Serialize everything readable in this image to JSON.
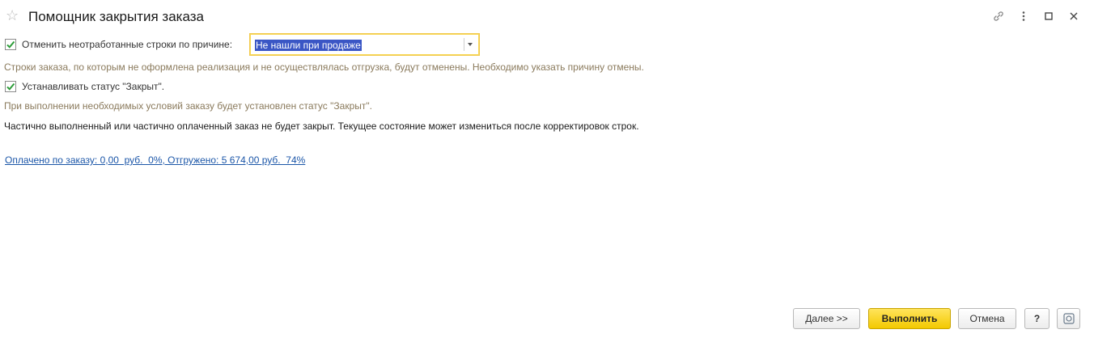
{
  "window": {
    "title": "Помощник закрытия заказа"
  },
  "options": {
    "cancel_rows": {
      "checked": true,
      "label": "Отменить неотработанные строки по причине:",
      "reason_value": "Не нашли при продаже",
      "hint": "Строки заказа, по которым не оформлена реализация и не осуществлялась отгрузка, будут отменены. Необходимо указать причину отмены."
    },
    "set_status": {
      "checked": true,
      "label": "Устанавливать статус \"Закрыт\".",
      "hint": "При выполнении необходимых условий заказу будет установлен статус \"Закрыт\"."
    }
  },
  "note": "Частично выполненный или частично оплаченный заказ не будет закрыт. Текущее состояние может измениться после корректировок строк.",
  "summary_link": "Оплачено по заказу: 0,00  руб.  0%, Отгружено: 5 674,00 руб.  74%",
  "buttons": {
    "next": "Далее >>",
    "execute": "Выполнить",
    "cancel": "Отмена",
    "help": "?"
  },
  "icons": {
    "favorite": "star-icon",
    "link": "link-icon",
    "more": "more-vertical-icon",
    "maximize": "maximize-icon",
    "close": "close-icon",
    "settings": "settings-icon"
  },
  "colors": {
    "accent_yellow": "#f3c900",
    "hint_text": "#8a7a5c",
    "link": "#1b56a8",
    "selection": "#3a56c5",
    "check": "#2e9d3a"
  }
}
